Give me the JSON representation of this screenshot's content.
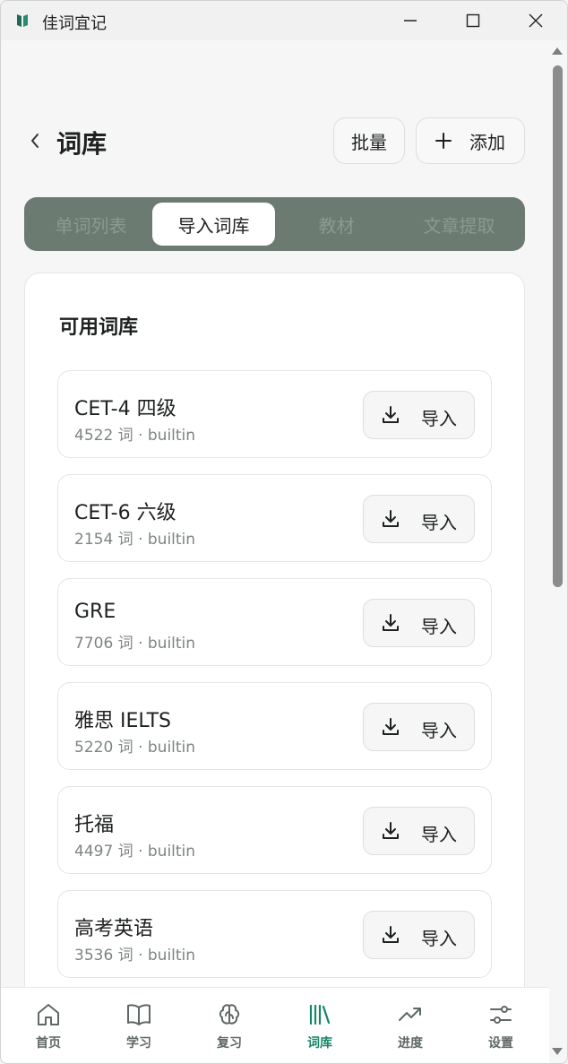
{
  "window": {
    "title": "佳词宜记",
    "controls": [
      "minimize-icon",
      "maximize-icon",
      "close-icon"
    ]
  },
  "header": {
    "title": "词库",
    "batch_label": "批量",
    "add_label": "添加"
  },
  "tabs": [
    {
      "label": "单词列表",
      "active": false
    },
    {
      "label": "导入词库",
      "active": true
    },
    {
      "label": "教材",
      "active": false
    },
    {
      "label": "文章提取",
      "active": false
    }
  ],
  "library": {
    "title": "可用词库",
    "import_label": "导入",
    "items": [
      {
        "name": "CET-4 四级",
        "meta": "4522 词 · builtin"
      },
      {
        "name": "CET-6 六级",
        "meta": "2154 词 · builtin"
      },
      {
        "name": "GRE",
        "meta": "7706 词 · builtin"
      },
      {
        "name": "雅思 IELTS",
        "meta": "5220 词 · builtin"
      },
      {
        "name": "托福",
        "meta": "4497 词 · builtin"
      },
      {
        "name": "高考英语",
        "meta": "3536 词 · builtin"
      }
    ]
  },
  "nav": [
    {
      "label": "首页",
      "icon": "home-icon",
      "active": false
    },
    {
      "label": "学习",
      "icon": "book-icon",
      "active": false
    },
    {
      "label": "复习",
      "icon": "brain-icon",
      "active": false
    },
    {
      "label": "词库",
      "icon": "library-icon",
      "active": true
    },
    {
      "label": "进度",
      "icon": "trend-icon",
      "active": false
    },
    {
      "label": "设置",
      "icon": "sliders-icon",
      "active": false
    }
  ],
  "colors": {
    "accent": "#15866a",
    "tab_bar": "#6b7b72",
    "text": "#1d211f"
  }
}
